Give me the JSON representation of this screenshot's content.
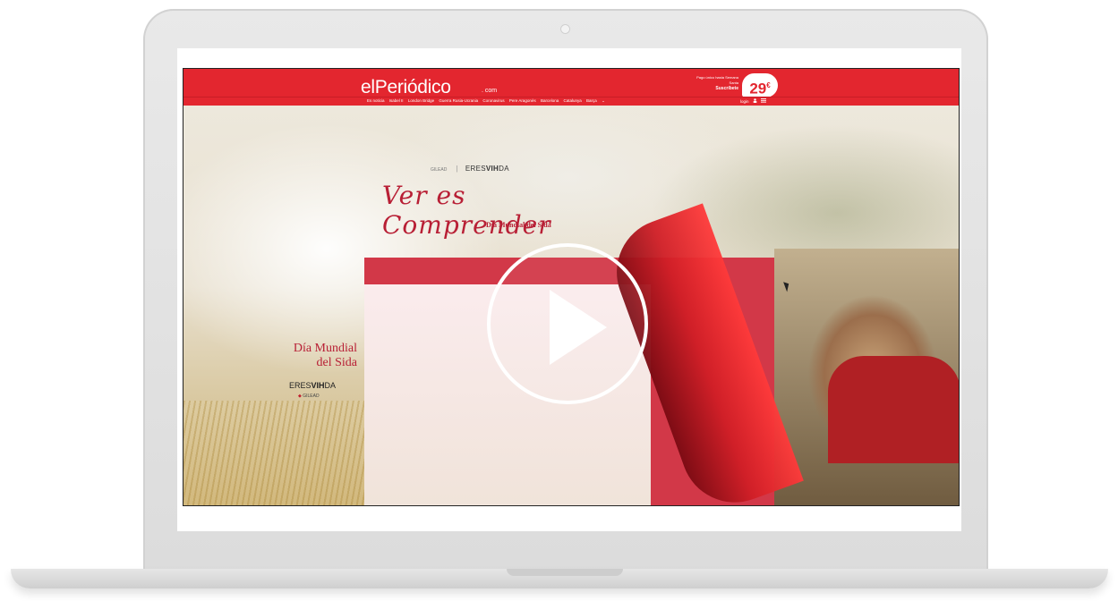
{
  "header": {
    "logo": "elPeriódico",
    "logo_suffix": ". com",
    "promo_line1": "Pago único hasta Semana",
    "promo_line2": "Santa",
    "promo_cta": "Suscríbete",
    "price": "29",
    "price_currency": "€",
    "accent_color": "#e3262f"
  },
  "nav": {
    "items": [
      "Es noticia",
      "Isabel II",
      "London Bridge",
      "Guerra Rusia-Ucrania",
      "Coronavirus",
      "Pere Aragonès",
      "Barcelona",
      "Catalunya",
      "Barça",
      "⌄"
    ],
    "login": "login",
    "user_icon": "user-icon",
    "menu_icon": "menu-icon"
  },
  "ad": {
    "sponsor_gilead": "GILEAD",
    "sponsor_sep": "|",
    "eres_prefix": "ERES",
    "eres_bold": "VIH",
    "eres_suffix": "DA",
    "headline": "Ver es Comprender",
    "subhead": "Día Mundial del Sida",
    "side_title_line1": "Día Mundial",
    "side_title_line2": "del Sida",
    "side_gilead": "GILEAD",
    "ribbon_color": "#d01e26"
  },
  "video": {
    "play_icon": "play-icon"
  }
}
